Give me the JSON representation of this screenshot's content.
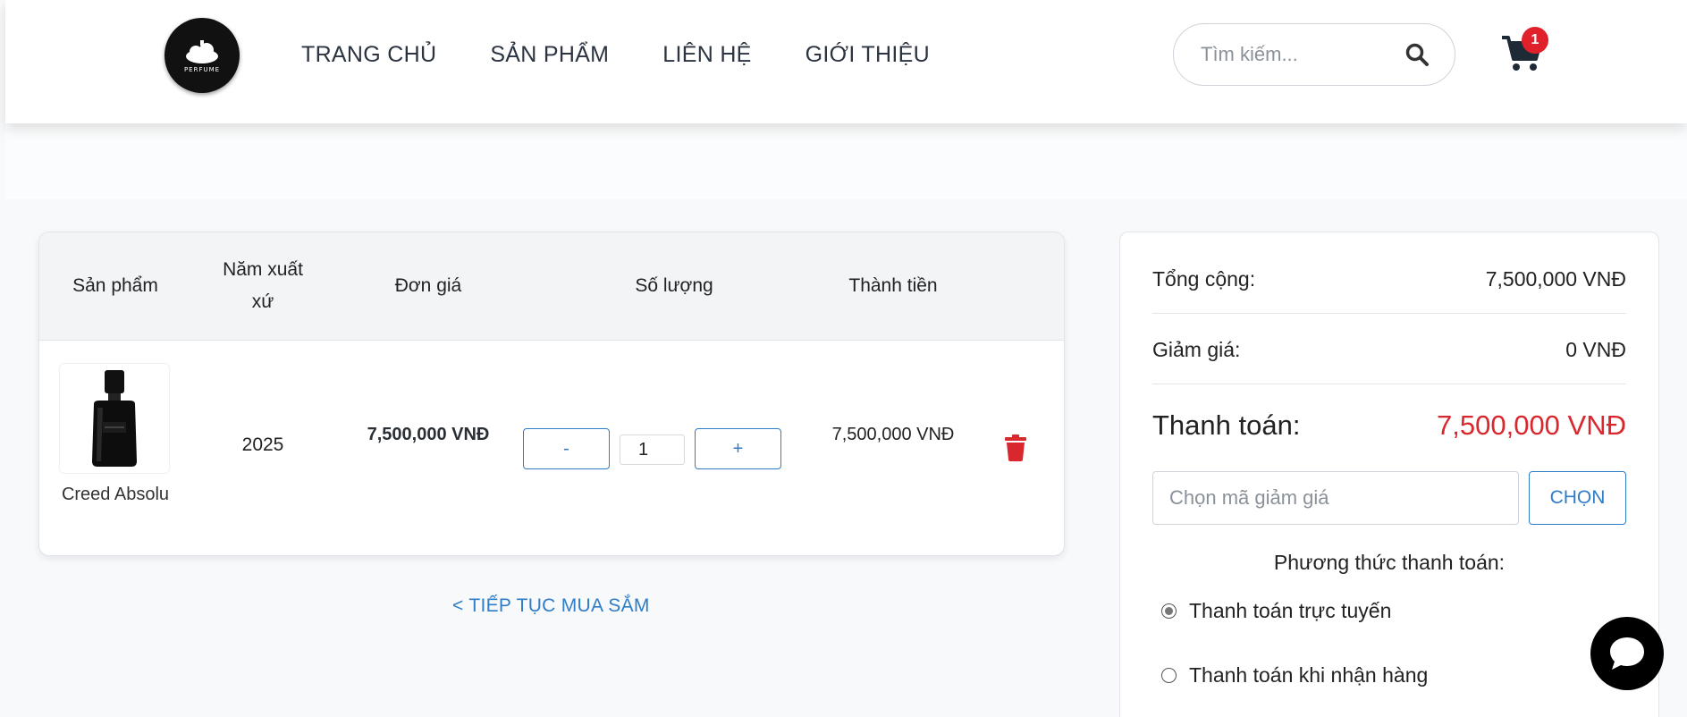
{
  "header": {
    "logo_text": "PERFUME",
    "nav": [
      "TRANG CHỦ",
      "SẢN PHẨM",
      "LIÊN HỆ",
      "GIỚI THIỆU"
    ],
    "search_placeholder": "Tìm kiếm...",
    "cart_count": "1"
  },
  "cart": {
    "columns": [
      "Sản phẩm",
      "Năm xuất xứ",
      "Đơn giá",
      "Số lượng",
      "Thành tiền"
    ],
    "items": [
      {
        "name": "Creed Absolu",
        "year": "2025",
        "unit_price": "7,500,000 VNĐ",
        "quantity": "1",
        "line_total": "7,500,000 VNĐ"
      }
    ],
    "minus_label": "-",
    "plus_label": "+",
    "continue_label": "< TIẾP TỤC MUA SẮM"
  },
  "summary": {
    "total_label": "Tổng cộng:",
    "total_value": "7,500,000 VNĐ",
    "discount_label": "Giảm giá:",
    "discount_value": "0 VNĐ",
    "pay_label": "Thanh toán:",
    "pay_value": "7,500,000 VNĐ",
    "coupon_placeholder": "Chọn mã giảm giá",
    "coupon_button": "CHỌN",
    "payment_title": "Phương thức thanh toán:",
    "payment_methods": [
      {
        "label": "Thanh toán trực tuyến",
        "checked": true
      },
      {
        "label": "Thanh toán khi nhận hàng",
        "checked": false
      }
    ]
  },
  "colors": {
    "accent": "#2f7cc7",
    "price_red": "#d9272e",
    "badge_red": "#e0202a"
  }
}
